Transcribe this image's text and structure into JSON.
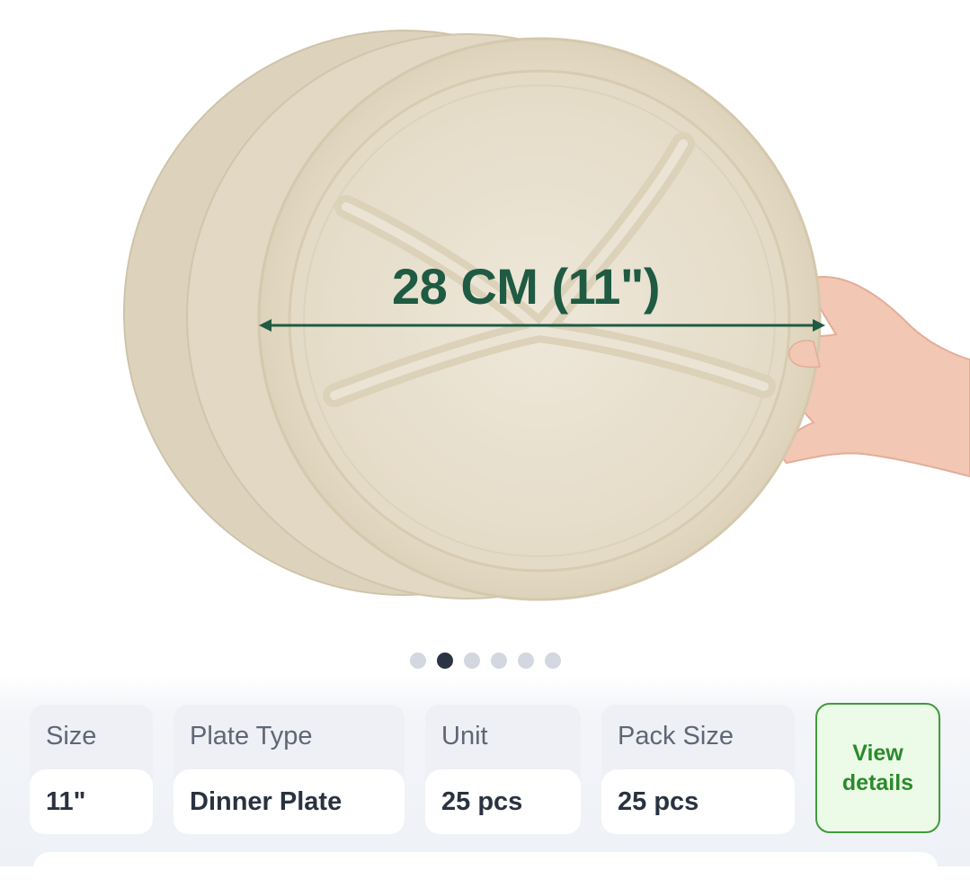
{
  "product_image": {
    "dimension_label": "28 CM (11\")",
    "carousel": {
      "total": 6,
      "active_index": 1
    }
  },
  "specs": [
    {
      "label": "Size",
      "value": "11\""
    },
    {
      "label": "Plate Type",
      "value": "Dinner Plate"
    },
    {
      "label": "Unit",
      "value": "25 pcs"
    },
    {
      "label": "Pack Size",
      "value": "25 pcs"
    }
  ],
  "actions": {
    "view_details_line1": "View",
    "view_details_line2": "details"
  },
  "colors": {
    "accent_green": "#3f9a3a",
    "dimension_text": "#1f5a43",
    "plate": "#e8dfcc"
  }
}
